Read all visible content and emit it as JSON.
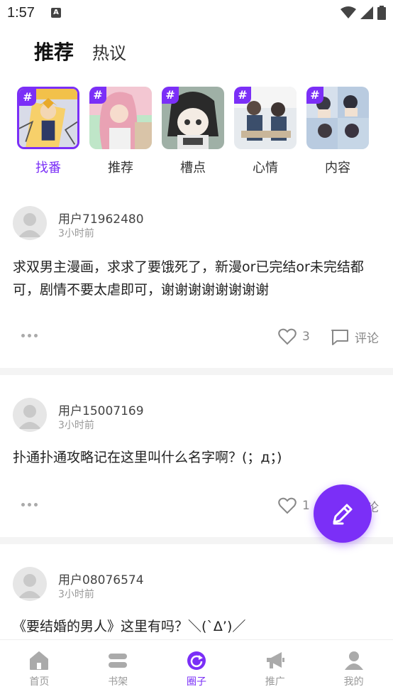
{
  "status_bar": {
    "time": "1:57",
    "notification_glyph": "A"
  },
  "top_tabs": [
    {
      "label": "推荐",
      "active": true
    },
    {
      "label": "热议",
      "active": false
    }
  ],
  "categories": [
    {
      "label": "找番",
      "active": true
    },
    {
      "label": "推荐",
      "active": false
    },
    {
      "label": "槽点",
      "active": false
    },
    {
      "label": "心情",
      "active": false
    },
    {
      "label": "内容",
      "active": false
    }
  ],
  "category_hash": "#",
  "posts": [
    {
      "username": "用户71962480",
      "time": "3小时前",
      "content": "求双男主漫画，求求了要饿死了，新漫or已完结or未完结都可，剧情不要太虐即可，谢谢谢谢谢谢谢谢",
      "likes": "3",
      "comment_label": "评论"
    },
    {
      "username": "用户15007169",
      "time": "3小时前",
      "content": "扑通扑通攻略记在这里叫什么名字啊？(；д；)",
      "likes": "1",
      "comment_label": "评论"
    },
    {
      "username": "用户08076574",
      "time": "3小时前",
      "content": "《要结婚的男人》这里有吗？＼(`Δ’)／"
    }
  ],
  "bottom_nav": [
    {
      "label": "首页",
      "active": false,
      "icon": "home-icon"
    },
    {
      "label": "书架",
      "active": false,
      "icon": "bookshelf-icon"
    },
    {
      "label": "圈子",
      "active": true,
      "icon": "circle-icon"
    },
    {
      "label": "推广",
      "active": false,
      "icon": "megaphone-icon"
    },
    {
      "label": "我的",
      "active": false,
      "icon": "profile-icon"
    }
  ],
  "colors": {
    "accent": "#7b2ff7",
    "tab_highlight": "#2ee6c0",
    "muted": "#999999"
  }
}
